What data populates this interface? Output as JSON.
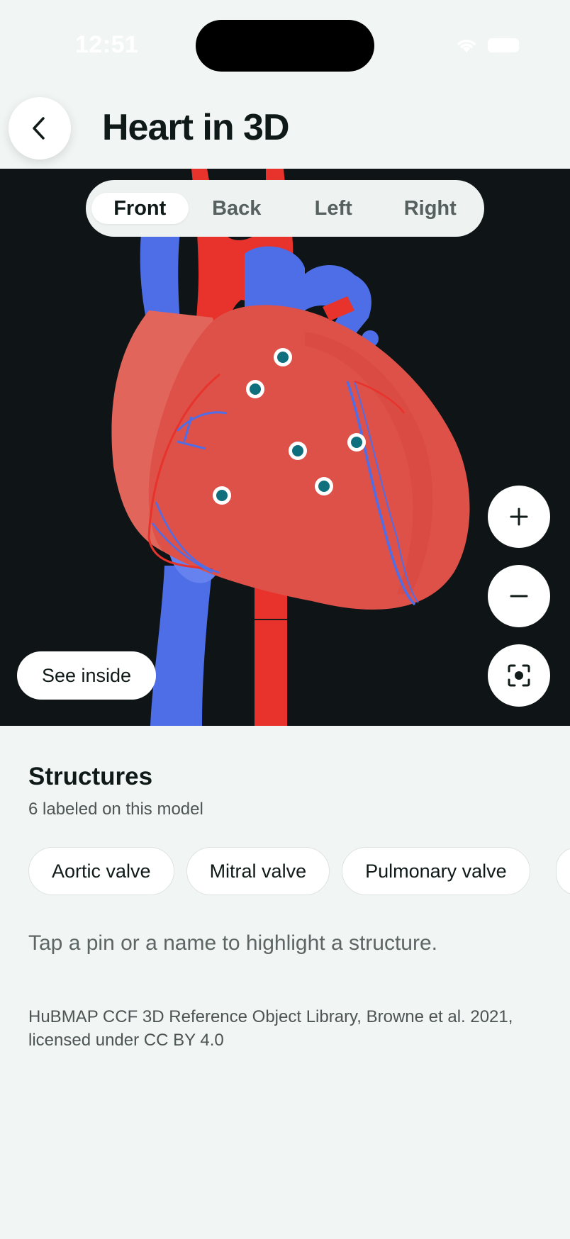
{
  "status_bar": {
    "time": "12:51"
  },
  "header": {
    "title": "Heart in 3D"
  },
  "viewer": {
    "tabs": [
      {
        "label": "Front",
        "active": true
      },
      {
        "label": "Back",
        "active": false
      },
      {
        "label": "Left",
        "active": false
      },
      {
        "label": "Right",
        "active": false
      }
    ],
    "see_inside_label": "See inside",
    "pin_count": 6
  },
  "structures": {
    "title": "Structures",
    "subtitle": "6 labeled on this model",
    "chips": [
      "Aortic valve",
      "Mitral valve",
      "Pulmonary valve"
    ],
    "hint": "Tap a pin or a name to highlight a structure."
  },
  "credit": "HuBMAP CCF 3D Reference Object Library, Browne et al. 2021, licensed under CC BY 4.0",
  "colors": {
    "background": "#f1f5f4",
    "viewer_background": "#0f1516",
    "heart_red": "#de5149",
    "vessel_red": "#e8332c",
    "vein_blue": "#4e6ee8",
    "pin": "#0f6f7d"
  }
}
